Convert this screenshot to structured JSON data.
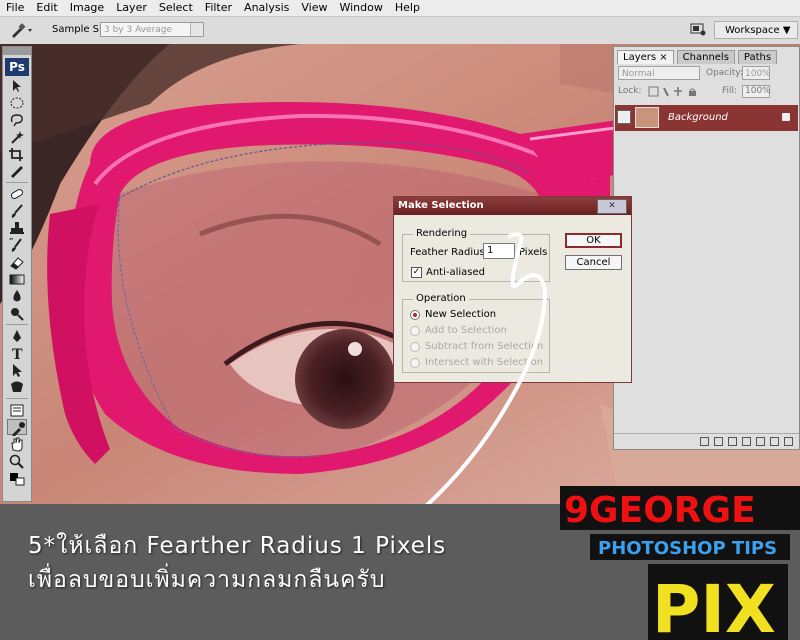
{
  "menu": [
    "File",
    "Edit",
    "Image",
    "Layer",
    "Select",
    "Filter",
    "Analysis",
    "View",
    "Window",
    "Help"
  ],
  "options": {
    "sample_label": "Sample Size:",
    "sample_value": "3 by 3 Average",
    "workspace": "Workspace ▼"
  },
  "toolbox": {
    "logo": "Ps"
  },
  "layers_panel": {
    "tabs": [
      "Layers ×",
      "Channels",
      "Paths"
    ],
    "blend_mode": "Normal",
    "opacity_label": "Opacity:",
    "opacity_value": "100%",
    "lock_label": "Lock:",
    "fill_label": "Fill:",
    "fill_value": "100%",
    "layer_name": "Background"
  },
  "dialog": {
    "title": "Make Selection",
    "close": "✕",
    "rendering": "Rendering",
    "feather_label": "Feather Radius:",
    "feather_value": "1",
    "feather_unit": "Pixels",
    "anti_alias": "Anti-aliased",
    "operation": "Operation",
    "options": [
      "New Selection",
      "Add to Selection",
      "Subtract from Selection",
      "Intersect with Selection"
    ],
    "ok": "OK",
    "cancel": "Cancel"
  },
  "caption": {
    "line1": "5*ให้เลือก Fearther Radius 1 Pixels",
    "line2": "เพื่อลบขอบเพิ่มความกลมกลืนครับ"
  },
  "logo": {
    "brand": "9GEORGE",
    "sub": "PHOTOSHOP TIPS",
    "big": "PIX"
  },
  "colors": {
    "frame": "#e0186e",
    "skin": "#c98878",
    "dialog_title": "#7a2828",
    "layer_active": "#8a3434"
  }
}
